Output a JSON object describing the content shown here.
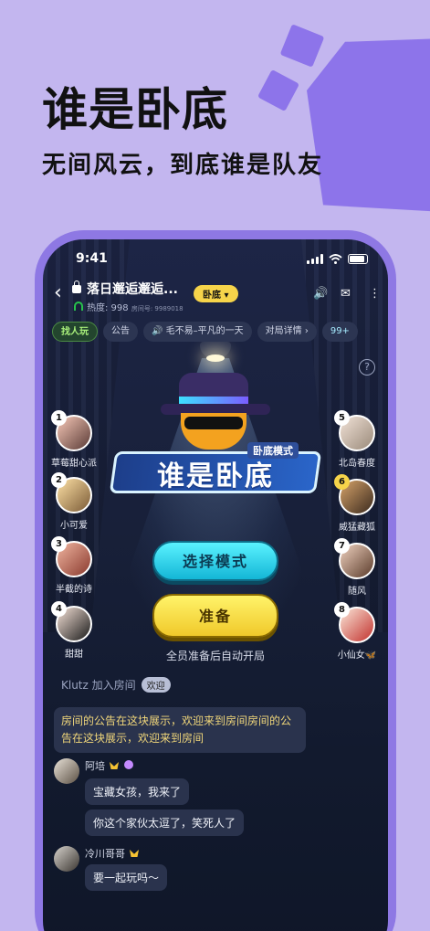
{
  "promo": {
    "headline": "谁是卧底",
    "subheadline": "无间风云，到底谁是队友"
  },
  "status_bar": {
    "time": "9:41"
  },
  "room": {
    "title": "落日邂逅邂逅...",
    "heat": "热度: 998",
    "room_id": "房间号: 9989018",
    "game_tag": "卧底"
  },
  "subbar": {
    "find_player": "找人玩",
    "announcement": "公告",
    "music": "毛不易–平凡的一天",
    "round_detail": "对局详情 ›",
    "online_count": "99+"
  },
  "seats": {
    "left": [
      {
        "num": "1",
        "name": "草莓甜心派"
      },
      {
        "num": "2",
        "name": "小可爱"
      },
      {
        "num": "3",
        "name": "半截的诗"
      },
      {
        "num": "4",
        "name": "甜甜"
      }
    ],
    "right": [
      {
        "num": "5",
        "name": "北岛春度"
      },
      {
        "num": "6",
        "name": "威猛藏狐"
      },
      {
        "num": "7",
        "name": "随风"
      },
      {
        "num": "8",
        "name": "小仙女🦋"
      }
    ]
  },
  "game": {
    "mode_badge": "卧底模式",
    "logo_text": "谁是卧底"
  },
  "buttons": {
    "select_mode": "选择模式",
    "ready": "准备",
    "auto_start": "全员准备后自动开局"
  },
  "chat": {
    "system_join": "Klutz 加入房间",
    "welcome_btn": "欢迎",
    "notice": "房间的公告在这块展示，欢迎来到房间房间的公告在这块展示，欢迎来到房间",
    "messages": [
      {
        "user": "阿培",
        "lines": [
          "宝藏女孩，我来了",
          "你这个家伙太逗了，笑死人了"
        ]
      },
      {
        "user": "冷川哥哥",
        "lines": [
          "要一起玩吗～"
        ]
      }
    ]
  },
  "colors": {
    "background": "#c3b6ef",
    "phone_frame": "#8e78e4",
    "accent_yellow": "#f6d44a",
    "accent_cyan": "#3de0ff"
  }
}
